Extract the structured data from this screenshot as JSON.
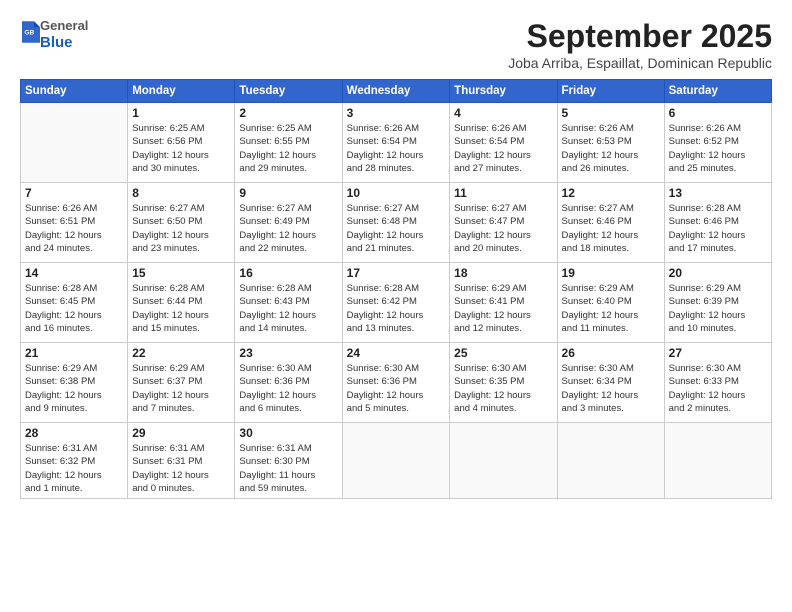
{
  "logo": {
    "general": "General",
    "blue": "Blue"
  },
  "title": "September 2025",
  "location": "Joba Arriba, Espaillat, Dominican Republic",
  "days_of_week": [
    "Sunday",
    "Monday",
    "Tuesday",
    "Wednesday",
    "Thursday",
    "Friday",
    "Saturday"
  ],
  "weeks": [
    [
      {
        "day": "",
        "content": ""
      },
      {
        "day": "1",
        "content": "Sunrise: 6:25 AM\nSunset: 6:56 PM\nDaylight: 12 hours\nand 30 minutes."
      },
      {
        "day": "2",
        "content": "Sunrise: 6:25 AM\nSunset: 6:55 PM\nDaylight: 12 hours\nand 29 minutes."
      },
      {
        "day": "3",
        "content": "Sunrise: 6:26 AM\nSunset: 6:54 PM\nDaylight: 12 hours\nand 28 minutes."
      },
      {
        "day": "4",
        "content": "Sunrise: 6:26 AM\nSunset: 6:54 PM\nDaylight: 12 hours\nand 27 minutes."
      },
      {
        "day": "5",
        "content": "Sunrise: 6:26 AM\nSunset: 6:53 PM\nDaylight: 12 hours\nand 26 minutes."
      },
      {
        "day": "6",
        "content": "Sunrise: 6:26 AM\nSunset: 6:52 PM\nDaylight: 12 hours\nand 25 minutes."
      }
    ],
    [
      {
        "day": "7",
        "content": "Sunrise: 6:26 AM\nSunset: 6:51 PM\nDaylight: 12 hours\nand 24 minutes."
      },
      {
        "day": "8",
        "content": "Sunrise: 6:27 AM\nSunset: 6:50 PM\nDaylight: 12 hours\nand 23 minutes."
      },
      {
        "day": "9",
        "content": "Sunrise: 6:27 AM\nSunset: 6:49 PM\nDaylight: 12 hours\nand 22 minutes."
      },
      {
        "day": "10",
        "content": "Sunrise: 6:27 AM\nSunset: 6:48 PM\nDaylight: 12 hours\nand 21 minutes."
      },
      {
        "day": "11",
        "content": "Sunrise: 6:27 AM\nSunset: 6:47 PM\nDaylight: 12 hours\nand 20 minutes."
      },
      {
        "day": "12",
        "content": "Sunrise: 6:27 AM\nSunset: 6:46 PM\nDaylight: 12 hours\nand 18 minutes."
      },
      {
        "day": "13",
        "content": "Sunrise: 6:28 AM\nSunset: 6:46 PM\nDaylight: 12 hours\nand 17 minutes."
      }
    ],
    [
      {
        "day": "14",
        "content": "Sunrise: 6:28 AM\nSunset: 6:45 PM\nDaylight: 12 hours\nand 16 minutes."
      },
      {
        "day": "15",
        "content": "Sunrise: 6:28 AM\nSunset: 6:44 PM\nDaylight: 12 hours\nand 15 minutes."
      },
      {
        "day": "16",
        "content": "Sunrise: 6:28 AM\nSunset: 6:43 PM\nDaylight: 12 hours\nand 14 minutes."
      },
      {
        "day": "17",
        "content": "Sunrise: 6:28 AM\nSunset: 6:42 PM\nDaylight: 12 hours\nand 13 minutes."
      },
      {
        "day": "18",
        "content": "Sunrise: 6:29 AM\nSunset: 6:41 PM\nDaylight: 12 hours\nand 12 minutes."
      },
      {
        "day": "19",
        "content": "Sunrise: 6:29 AM\nSunset: 6:40 PM\nDaylight: 12 hours\nand 11 minutes."
      },
      {
        "day": "20",
        "content": "Sunrise: 6:29 AM\nSunset: 6:39 PM\nDaylight: 12 hours\nand 10 minutes."
      }
    ],
    [
      {
        "day": "21",
        "content": "Sunrise: 6:29 AM\nSunset: 6:38 PM\nDaylight: 12 hours\nand 9 minutes."
      },
      {
        "day": "22",
        "content": "Sunrise: 6:29 AM\nSunset: 6:37 PM\nDaylight: 12 hours\nand 7 minutes."
      },
      {
        "day": "23",
        "content": "Sunrise: 6:30 AM\nSunset: 6:36 PM\nDaylight: 12 hours\nand 6 minutes."
      },
      {
        "day": "24",
        "content": "Sunrise: 6:30 AM\nSunset: 6:36 PM\nDaylight: 12 hours\nand 5 minutes."
      },
      {
        "day": "25",
        "content": "Sunrise: 6:30 AM\nSunset: 6:35 PM\nDaylight: 12 hours\nand 4 minutes."
      },
      {
        "day": "26",
        "content": "Sunrise: 6:30 AM\nSunset: 6:34 PM\nDaylight: 12 hours\nand 3 minutes."
      },
      {
        "day": "27",
        "content": "Sunrise: 6:30 AM\nSunset: 6:33 PM\nDaylight: 12 hours\nand 2 minutes."
      }
    ],
    [
      {
        "day": "28",
        "content": "Sunrise: 6:31 AM\nSunset: 6:32 PM\nDaylight: 12 hours\nand 1 minute."
      },
      {
        "day": "29",
        "content": "Sunrise: 6:31 AM\nSunset: 6:31 PM\nDaylight: 12 hours\nand 0 minutes."
      },
      {
        "day": "30",
        "content": "Sunrise: 6:31 AM\nSunset: 6:30 PM\nDaylight: 11 hours\nand 59 minutes."
      },
      {
        "day": "",
        "content": ""
      },
      {
        "day": "",
        "content": ""
      },
      {
        "day": "",
        "content": ""
      },
      {
        "day": "",
        "content": ""
      }
    ]
  ]
}
